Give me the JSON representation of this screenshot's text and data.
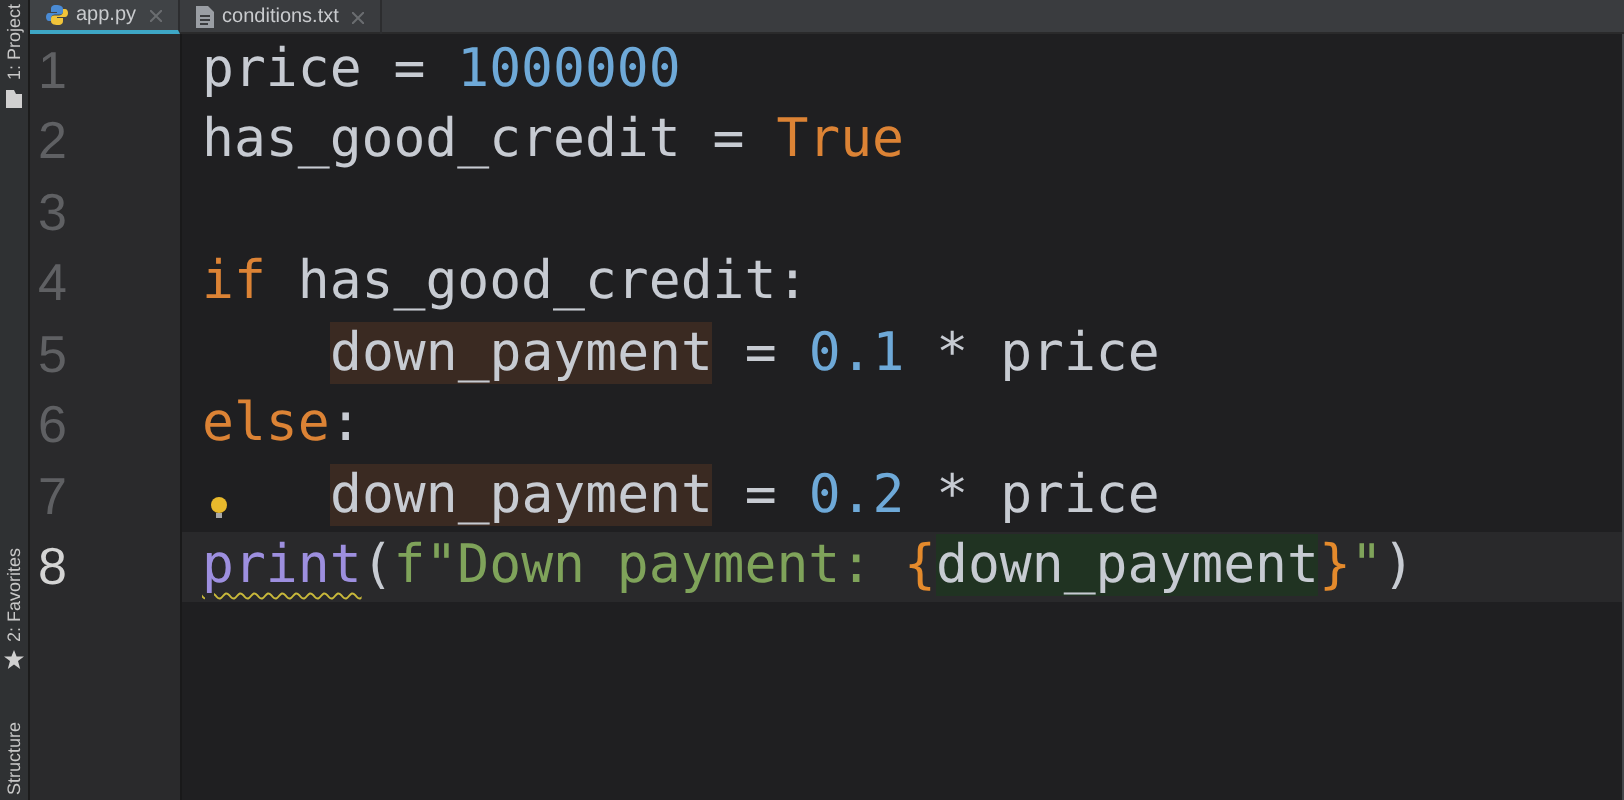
{
  "tool_windows": [
    {
      "label": "1: Project",
      "kind": "folder"
    },
    {
      "label": "2: Favorites",
      "kind": "star"
    },
    {
      "label": "Structure",
      "kind": "plain"
    }
  ],
  "tabs": [
    {
      "label": "app.py",
      "kind": "python",
      "selected": true
    },
    {
      "label": "conditions.txt",
      "kind": "text",
      "selected": false
    }
  ],
  "lines": [
    {
      "number": "1",
      "current": false,
      "indented": false,
      "bulb": false,
      "tokens": [
        {
          "text": "price = ",
          "kind": "plain"
        },
        {
          "text": "1000000",
          "kind": "number"
        }
      ]
    },
    {
      "number": "2",
      "current": false,
      "indented": false,
      "bulb": false,
      "tokens": [
        {
          "text": "has_good_credit = ",
          "kind": "plain"
        },
        {
          "text": "True",
          "kind": "keyword"
        }
      ]
    },
    {
      "number": "3",
      "current": false,
      "bulb": false
    },
    {
      "number": "4",
      "current": false,
      "indented": false,
      "bulb": false,
      "tokens": [
        {
          "text": "if",
          "kind": "keyword"
        },
        {
          "text": " has_good_credit:",
          "kind": "plain"
        }
      ]
    },
    {
      "number": "5",
      "current": false,
      "indented": true,
      "bulb": false,
      "tokens": [
        {
          "text": "down_payment",
          "kind": "shadowed"
        },
        {
          "text": " = ",
          "kind": "plain"
        },
        {
          "text": "0.1",
          "kind": "number"
        },
        {
          "text": " * price",
          "kind": "plain"
        }
      ]
    },
    {
      "number": "6",
      "current": false,
      "indented": false,
      "bulb": false,
      "tokens": [
        {
          "text": "else",
          "kind": "keyword"
        },
        {
          "text": ":",
          "kind": "plain"
        }
      ]
    },
    {
      "number": "7",
      "current": false,
      "indented": true,
      "bulb": true,
      "tokens": [
        {
          "text": "down_payment",
          "kind": "shadowed"
        },
        {
          "text": " = ",
          "kind": "plain"
        },
        {
          "text": "0.2",
          "kind": "number"
        },
        {
          "text": " * price",
          "kind": "plain"
        }
      ]
    },
    {
      "number": "8",
      "current": true,
      "indented": false,
      "bulb": false,
      "tokens": [
        {
          "text": "print",
          "kind": "warned_call"
        },
        {
          "text": "(",
          "kind": "plain"
        },
        {
          "text": "f\"Down payment: ",
          "kind": "string"
        },
        {
          "text": "{",
          "kind": "brace"
        },
        {
          "text": "down_payment",
          "kind": "reference"
        },
        {
          "text": "}",
          "kind": "brace"
        },
        {
          "text": "\"",
          "kind": "string"
        },
        {
          "text": ")",
          "kind": "plain"
        }
      ]
    }
  ]
}
